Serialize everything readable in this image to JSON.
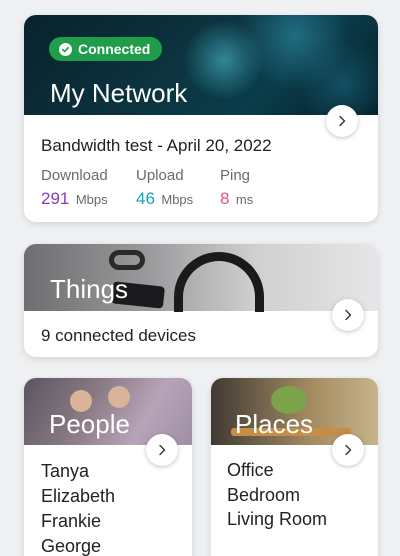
{
  "network": {
    "status": "Connected",
    "title": "My Network",
    "bandwidth_title": "Bandwidth test - April 20, 2022",
    "download": {
      "label": "Download",
      "value": "291",
      "unit": "Mbps",
      "color": "#8a3ab9"
    },
    "upload": {
      "label": "Upload",
      "value": "46",
      "unit": "Mbps",
      "color": "#1aa3b4"
    },
    "ping": {
      "label": "Ping",
      "value": "8",
      "unit": "ms",
      "color": "#e0508a"
    }
  },
  "things": {
    "title": "Things",
    "subtitle": "9 connected devices"
  },
  "people": {
    "title": "People",
    "names": [
      "Tanya",
      "Elizabeth",
      "Frankie",
      "George"
    ]
  },
  "places": {
    "title": "Places",
    "names": [
      "Office",
      "Bedroom",
      "Living Room"
    ]
  },
  "colors": {
    "connected": "#1f9d4a"
  }
}
